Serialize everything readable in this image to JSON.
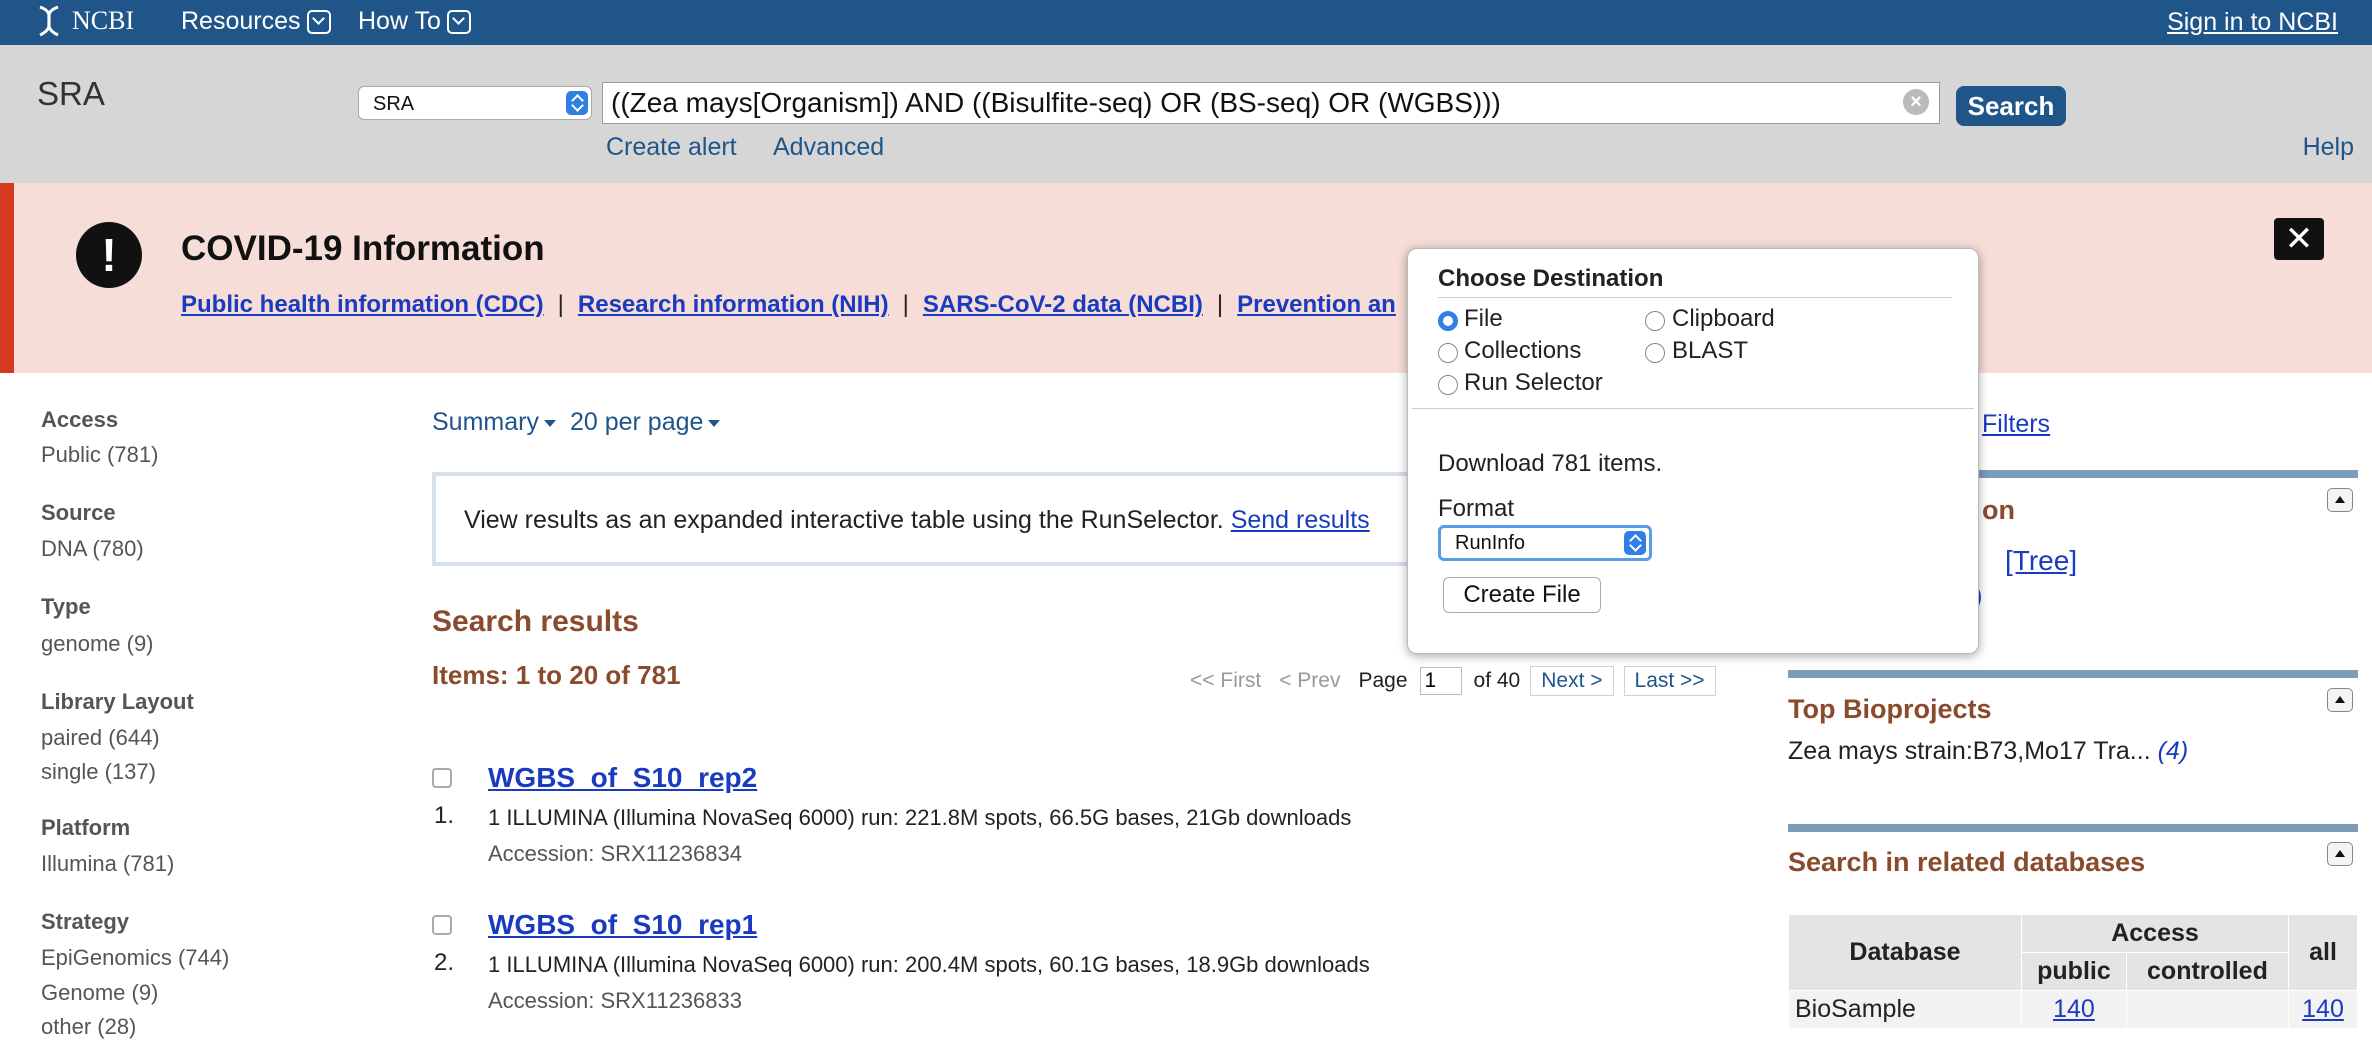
{
  "topbar": {
    "logo": "NCBI",
    "menu": [
      "Resources",
      "How To"
    ],
    "signin": "Sign in to NCBI"
  },
  "search": {
    "db_title": "SRA",
    "db_select": "SRA",
    "query": "((Zea mays[Organism]) AND ((Bisulfite-seq) OR (BS-seq) OR (WGBS)))",
    "button": "Search",
    "create_alert": "Create alert",
    "advanced": "Advanced",
    "help": "Help"
  },
  "covid": {
    "title": "COVID-19 Information",
    "links": [
      "Public health information (CDC)",
      "Research information (NIH)",
      "SARS-CoV-2 data (NCBI)",
      "Prevention an"
    ],
    "close": "✕"
  },
  "facets": [
    {
      "heading": "Access",
      "items": [
        "Public (781)"
      ]
    },
    {
      "heading": "Source",
      "items": [
        "DNA (780)"
      ]
    },
    {
      "heading": "Type",
      "items": [
        "genome (9)"
      ]
    },
    {
      "heading": "Library Layout",
      "items": [
        "paired (644)",
        "single (137)"
      ]
    },
    {
      "heading": "Platform",
      "items": [
        "Illumina (781)"
      ]
    },
    {
      "heading": "Strategy",
      "items": [
        "EpiGenomics (744)",
        "Genome (9)",
        "other (28)"
      ]
    }
  ],
  "view": {
    "format": "Summary",
    "per_page": "20 per page"
  },
  "runselector": {
    "text": "View results as an expanded interactive table using the RunSelector.",
    "link": "Send results"
  },
  "results": {
    "title": "Search results",
    "items": "Items: 1 to 20 of 781",
    "pager": {
      "first": "<< First",
      "prev": "< Prev",
      "page_label": "Page",
      "page": "1",
      "of": "of 40",
      "next": "Next >",
      "last": "Last >>"
    },
    "list": [
      {
        "num": "1.",
        "title": "WGBS_of_S10_rep2",
        "desc": "1 ILLUMINA (Illumina NovaSeq 6000) run: 221.8M spots, 66.5G bases, 21Gb downloads",
        "acc": "Accession: SRX11236834"
      },
      {
        "num": "2.",
        "title": "WGBS_of_S10_rep1",
        "desc": "1 ILLUMINA (Illumina NovaSeq 6000) run: 200.4M spots, 60.1G bases, 18.9Gb downloads",
        "acc": "Accession: SRX11236833"
      }
    ]
  },
  "right": {
    "filters": "Filters",
    "partial_head": "on",
    "tree": "[Tree]",
    "partial_count": "l)",
    "bioprojects_title": "Top Bioprojects",
    "bioproject": "Zea mays strain:B73,Mo17 Tra...",
    "bioproject_count": "(4)",
    "related_title": "Search in related databases",
    "table": {
      "h_database": "Database",
      "h_access": "Access",
      "h_all": "all",
      "h_public": "public",
      "h_controlled": "controlled",
      "row": {
        "db": "BioSample",
        "public": "140",
        "controlled": "",
        "all": "140"
      }
    }
  },
  "popup": {
    "title": "Choose Destination",
    "options": {
      "file": "File",
      "clipboard": "Clipboard",
      "collections": "Collections",
      "blast": "BLAST",
      "run_selector": "Run Selector"
    },
    "download": "Download 781 items.",
    "format_label": "Format",
    "format_value": "RunInfo",
    "create": "Create File"
  }
}
